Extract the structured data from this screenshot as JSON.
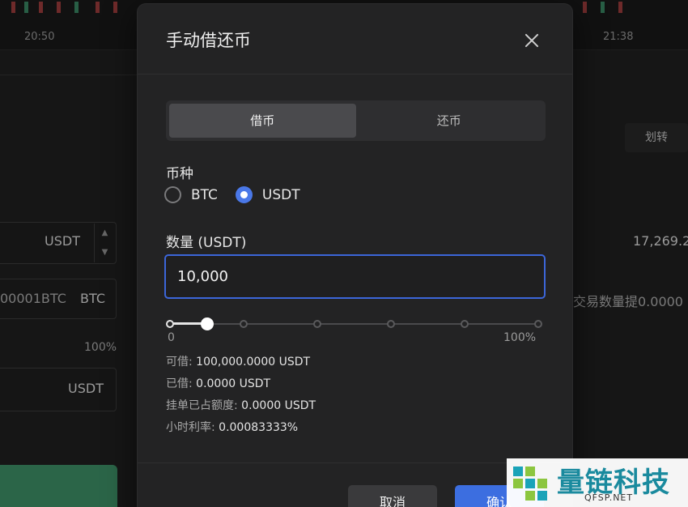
{
  "background": {
    "times": [
      "20:50",
      "21:38"
    ],
    "transfer_label": "划转",
    "currency_field_1": "USDT",
    "price_value": "17,269.2",
    "balance_text": "00001BTC",
    "balance_currency": "BTC",
    "trade_hint": "交易数量提0.0000",
    "percent_label": "100%",
    "currency_field_2": "USDT"
  },
  "modal": {
    "title": "手动借还币",
    "tabs": [
      {
        "label": "借币",
        "active": true
      },
      {
        "label": "还币",
        "active": false
      }
    ],
    "coin_label": "币种",
    "coin_options": [
      {
        "label": "BTC",
        "checked": false
      },
      {
        "label": "USDT",
        "checked": true
      }
    ],
    "amount_label": "数量 (USDT)",
    "amount_value": "10,000",
    "slider": {
      "min_label": "0",
      "max_label": "100%",
      "value_fraction": 0.1,
      "tick_count": 5
    },
    "info": [
      {
        "label": "可借: ",
        "value": "100,000.0000 USDT"
      },
      {
        "label": "已借: ",
        "value": "0.0000 USDT"
      },
      {
        "label": "挂单已占额度: ",
        "value": "0.0000 USDT"
      },
      {
        "label": "小时利率: ",
        "value": "0.00083333%"
      }
    ],
    "cancel_label": "取消",
    "confirm_label": "确认"
  },
  "watermark": {
    "text": "量链科技",
    "sub": "QFSP.NET"
  },
  "colors": {
    "accent": "#3c6ee0",
    "modal_bg": "#232324",
    "buy_green": "#2b6548"
  }
}
